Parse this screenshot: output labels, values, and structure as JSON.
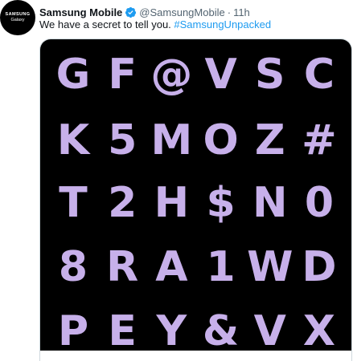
{
  "avatar": {
    "brand": "SAMSUNG",
    "sub": "Galaxy"
  },
  "tweet": {
    "name": "Samsung Mobile",
    "handle": "@SamsungMobile",
    "separator": "·",
    "time": "11h",
    "text": "We have a secret to tell you. ",
    "hashtag": "#SamsungUnpacked"
  },
  "media": {
    "rows": [
      [
        "G",
        "F",
        "@",
        "V",
        "S",
        "C"
      ],
      [
        "K",
        "5",
        "M",
        "O",
        "Z",
        "#"
      ],
      [
        "T",
        "2",
        "H",
        "$",
        "N",
        "0"
      ],
      [
        "8",
        "R",
        "A",
        "1",
        "W",
        "D"
      ],
      [
        "P",
        "E",
        "Y",
        "&",
        "V",
        "X"
      ]
    ]
  },
  "colors": {
    "glyph": "#c7b0ea",
    "background": "#000000",
    "verified": "#1d9bf0",
    "hashtag": "#1d9bf0"
  },
  "icons": {
    "verified": "verified-badge-icon"
  }
}
